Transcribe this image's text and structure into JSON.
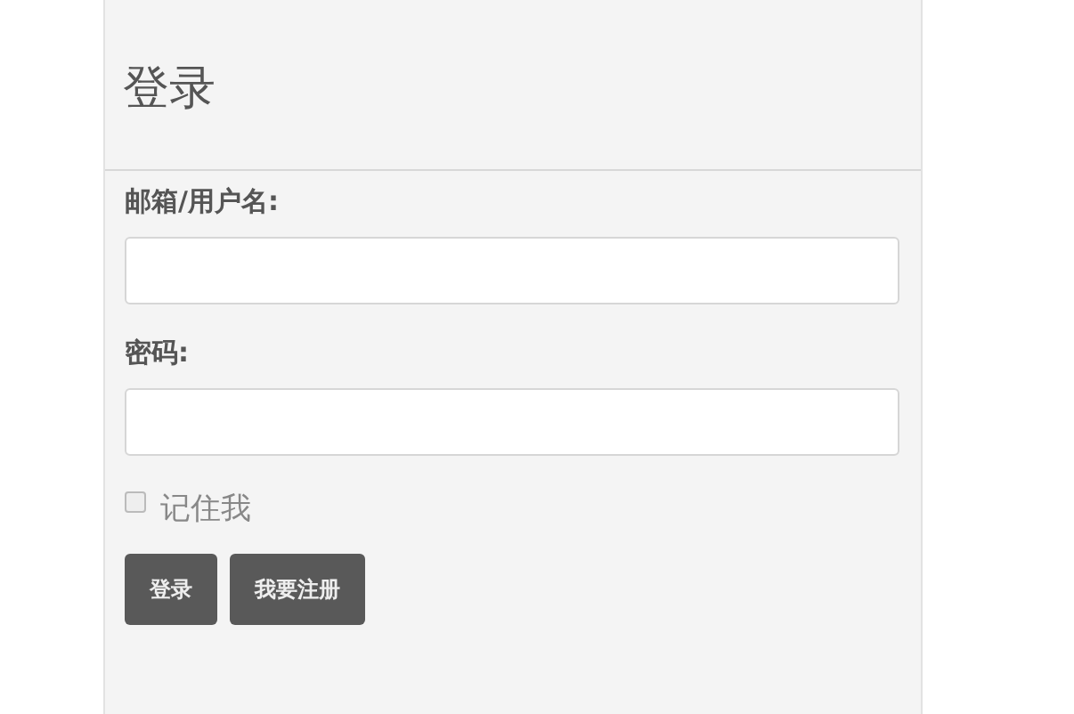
{
  "title": "登录",
  "fields": [
    {
      "label": "邮箱/用户名:"
    },
    {
      "label": "密码:"
    }
  ],
  "remember": {
    "label": "记住我",
    "checked": false
  },
  "buttons": [
    "登录",
    "我要注册"
  ]
}
